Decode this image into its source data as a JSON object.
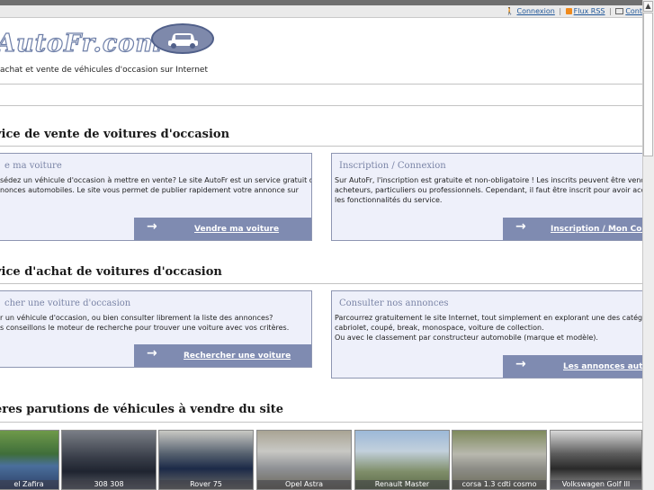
{
  "toplinks": {
    "connexion": "Connexion",
    "separator": "|",
    "rss": "Flux RSS",
    "contact": "Cont"
  },
  "header": {
    "logo": "AutoFr.com",
    "tagline": "achat et vente de véhicules d'occasion sur Internet"
  },
  "sections": {
    "vente_title": "vice de vente de voitures d'occasion",
    "achat_title": "vice d'achat de voitures d'occasion",
    "parutions_title": "eres parutions de véhicules à vendre du site"
  },
  "boxes": {
    "vendre": {
      "title": "e ma voiture",
      "text1": "sédez un véhicule d'occasion à mettre en vente? Le site AutoFr est un service gratuit de",
      "text2": "nonces automobiles. Le site vous permet de publier rapidement votre annonce sur",
      "button": "Vendre ma voiture"
    },
    "inscription": {
      "title": "Inscription / Connexion",
      "text1": "Sur AutoFr, l'inscription est gratuite et non-obligatoire ! Les inscrits peuvent être vendeu",
      "text2": "acheteurs, particuliers ou professionnels. Cependant, il faut être inscrit pour avoir accès",
      "text3": "les fonctionnalités du service.",
      "button": "Inscription / Mon Comp"
    },
    "rechercher": {
      "title": "cher une voiture d'occasion",
      "text1": "r un véhicule d'occasion, ou bien consulter librement la liste des annonces?",
      "text2": "s conseillons le moteur de recherche pour trouver une voiture avec vos critères.",
      "button": "Rechercher une voiture"
    },
    "consulter": {
      "title": "Consulter nos annonces",
      "text1": "Parcourrez gratuitement le site Internet, tout simplement en explorant une des catégorie",
      "text2": "cabriolet, coupé, break, monospace, voiture de collection.",
      "text3": "Ou avec le classement par constructeur automobile (marque et modèle).",
      "button": "Les annonces auto"
    }
  },
  "thumbnails": [
    {
      "caption": "el Zafira"
    },
    {
      "caption": "308 308"
    },
    {
      "caption": "Rover 75"
    },
    {
      "caption": "Opel Astra"
    },
    {
      "caption": "Renault Master"
    },
    {
      "caption": "corsa 1.3 cdti cosmo"
    },
    {
      "caption": "Volkswagen Golf III"
    }
  ],
  "colors": {
    "box_bg": "#eef0fa",
    "box_border": "#8e96b2",
    "button_bg": "#7f8bb1",
    "box_title": "#7a84a6",
    "link": "#22589a"
  },
  "icons": {
    "connexion": "person-icon",
    "rss": "rss-icon",
    "contact": "mail-icon",
    "button_arrow": "arrow-right-icon"
  }
}
